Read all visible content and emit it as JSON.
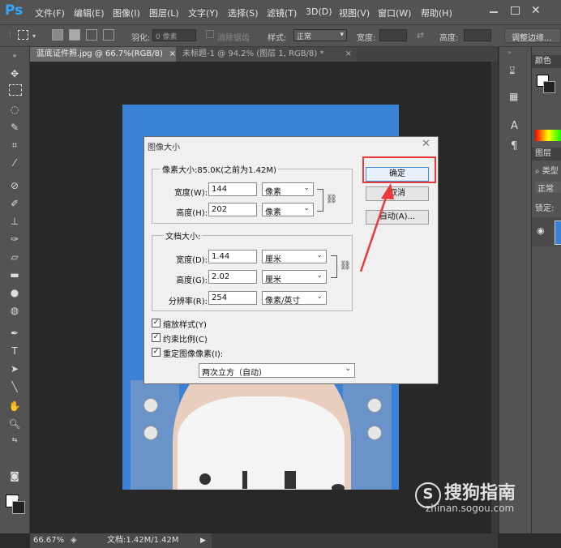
{
  "app": {
    "logo": "Ps"
  },
  "menu": [
    "文件(F)",
    "编辑(E)",
    "图像(I)",
    "图层(L)",
    "文字(Y)",
    "选择(S)",
    "滤镜(T)",
    "3D(D)",
    "视图(V)",
    "窗口(W)",
    "帮助(H)"
  ],
  "options": {
    "feather_label": "羽化:",
    "feather_value": "0 像素",
    "antialias_label": "消除锯齿",
    "style_label": "样式:",
    "style_value": "正常",
    "width_label": "宽度:",
    "height_label": "高度:",
    "refine_edge": "调整边缘..."
  },
  "tabs": [
    {
      "label": "蓝底证件照.jpg @ 66.7%(RGB/8)",
      "close": "×"
    },
    {
      "label": "未标题-1 @ 94.2% (图层 1, RGB/8) *",
      "close": "×"
    }
  ],
  "right_panel": {
    "color_tab": "颜色",
    "layers_tab": "图层",
    "search_label": "类型",
    "blend_mode": "正常",
    "lock_label": "锁定:"
  },
  "status": {
    "zoom": "66.67%",
    "doc": "文档:1.42M/1.42M"
  },
  "dialog": {
    "title": "图像大小",
    "pixel_group": "像素大小:85.0K(之前为1.42M)",
    "width_px_label": "宽度(W):",
    "width_px_value": "144",
    "width_px_unit": "像素",
    "height_px_label": "高度(H):",
    "height_px_value": "202",
    "height_px_unit": "像素",
    "doc_group": "文档大小:",
    "width_doc_label": "宽度(D):",
    "width_doc_value": "1.44",
    "width_doc_unit": "厘米",
    "height_doc_label": "高度(G):",
    "height_doc_value": "2.02",
    "height_doc_unit": "厘米",
    "resolution_label": "分辨率(R):",
    "resolution_value": "254",
    "resolution_unit": "像素/英寸",
    "scale_styles": "缩放样式(Y)",
    "constrain": "约束比例(C)",
    "resample": "重定图像像素(I):",
    "resample_method": "两次立方（自动）",
    "ok": "确定",
    "cancel": "取消",
    "auto": "自动(A)..."
  },
  "watermark": {
    "logo": "搜狗指南",
    "url": "zhinan.sogou.com"
  },
  "colors": {
    "highlight": "#e83a3a",
    "photo_bg": "#3b82d6",
    "arrow": "#e83a3a"
  }
}
